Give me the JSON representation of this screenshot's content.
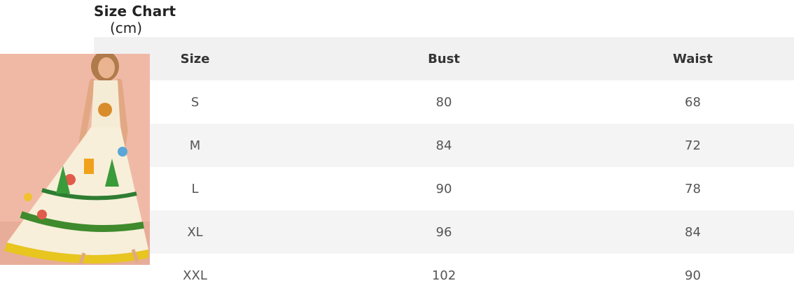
{
  "title": "Size Chart",
  "unit": "(cm)",
  "columns": [
    "Size",
    "Bust",
    "Waist"
  ],
  "rows": [
    {
      "size": "S",
      "bust": "80",
      "waist": "68"
    },
    {
      "size": "M",
      "bust": "84",
      "waist": "72"
    },
    {
      "size": "L",
      "bust": "90",
      "waist": "78"
    },
    {
      "size": "XL",
      "bust": "96",
      "waist": "84"
    },
    {
      "size": "XXL",
      "bust": "102",
      "waist": "90"
    }
  ],
  "photo": {
    "icon": "model-photo-icon",
    "background": "#f0b9a6"
  }
}
